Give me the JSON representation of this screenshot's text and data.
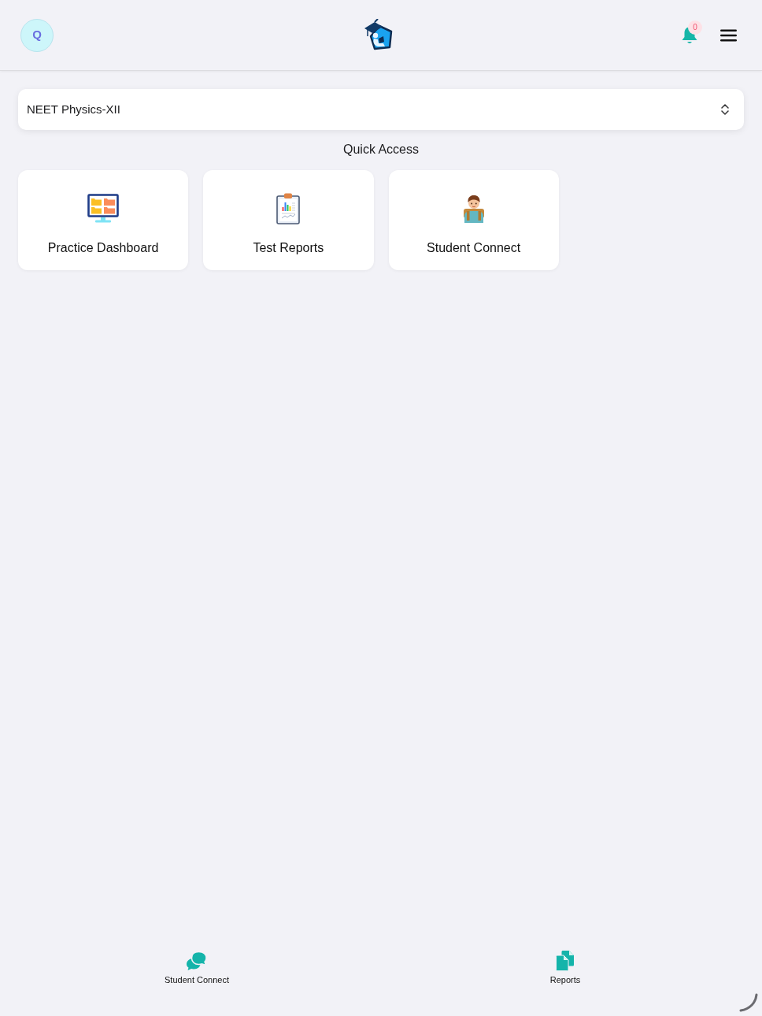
{
  "header": {
    "avatar_letter": "Q",
    "notification_count": "0"
  },
  "course_select": {
    "value": "NEET Physics-XII"
  },
  "quick_access": {
    "title": "Quick Access",
    "items": [
      {
        "label": "Practice Dashboard",
        "kind": "dashboard"
      },
      {
        "label": "Test Reports",
        "kind": "reports"
      },
      {
        "label": "Student Connect",
        "kind": "student"
      }
    ]
  },
  "bottom_nav": [
    {
      "label": "Student Connect",
      "kind": "chat"
    },
    {
      "label": "Reports",
      "kind": "documents"
    }
  ]
}
